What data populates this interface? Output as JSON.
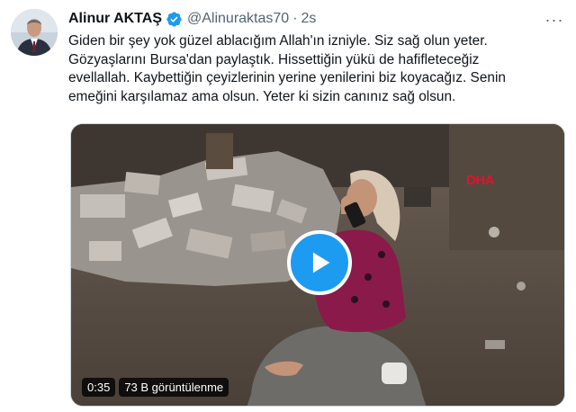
{
  "tweet": {
    "author_name": "Alinur AKTAŞ",
    "handle": "@Alinuraktas70",
    "separator": "·",
    "time": "2s",
    "more_label": "···",
    "text": "Giden bir şey yok güzel ablacığım Allah'ın izniyle. Siz sağ olun yeter.\nGözyaşlarını Bursa'dan paylaştık. Hissettiğin yükü de hafifleteceğiz\nevellallah. Kaybettiğin çeyizlerinin yerine yenilerini biz koyacağız. Senin\nemeğini karşılamaz ama olsun. Yeter ki sizin canınız sağ olsun."
  },
  "video": {
    "watermark": "DHA",
    "duration": "0:35",
    "views": "73 B görüntülenme"
  },
  "colors": {
    "accent": "#1d9bf0",
    "verified": "#1d9bf0",
    "secondary_text": "#536471"
  }
}
